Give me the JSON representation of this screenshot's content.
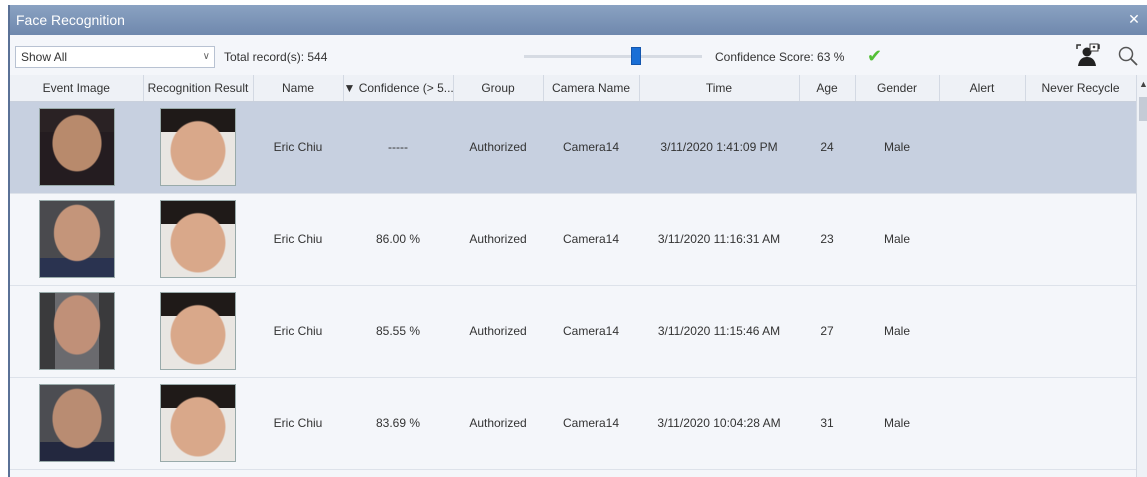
{
  "window": {
    "title": "Face Recognition",
    "close_glyph": "✕"
  },
  "toolbar": {
    "filter_value": "Show All",
    "total_label": "Total record(s): 544",
    "confidence_label": "Confidence Score: 63 %",
    "confidence_value": 63,
    "icons": [
      "face-settings-icon",
      "search-icon",
      "checkmark-icon"
    ]
  },
  "columns": [
    "Event Image",
    "Recognition Result",
    "Name",
    "▼ Confidence (> 5...",
    "Group",
    "Camera Name",
    "Time",
    "Age",
    "Gender",
    "Alert",
    "Never Recycle"
  ],
  "rows": [
    {
      "name": "Eric Chiu",
      "confidence": "-----",
      "group": "Authorized",
      "camera": "Camera14",
      "time": "3/11/2020 1:41:09 PM",
      "age": "24",
      "gender": "Male",
      "alert": "",
      "never_recycle": ""
    },
    {
      "name": "Eric Chiu",
      "confidence": "86.00 %",
      "group": "Authorized",
      "camera": "Camera14",
      "time": "3/11/2020 11:16:31 AM",
      "age": "23",
      "gender": "Male",
      "alert": "",
      "never_recycle": ""
    },
    {
      "name": "Eric Chiu",
      "confidence": "85.55 %",
      "group": "Authorized",
      "camera": "Camera14",
      "time": "3/11/2020 11:15:46 AM",
      "age": "27",
      "gender": "Male",
      "alert": "",
      "never_recycle": ""
    },
    {
      "name": "Eric Chiu",
      "confidence": "83.69 %",
      "group": "Authorized",
      "camera": "Camera14",
      "time": "3/11/2020 10:04:28 AM",
      "age": "31",
      "gender": "Male",
      "alert": "",
      "never_recycle": ""
    }
  ],
  "colors": {
    "titlebar": "#7890b4",
    "selected_row": "#c7d0e0",
    "slider_thumb": "#1a6fd6",
    "check": "#53c036"
  }
}
